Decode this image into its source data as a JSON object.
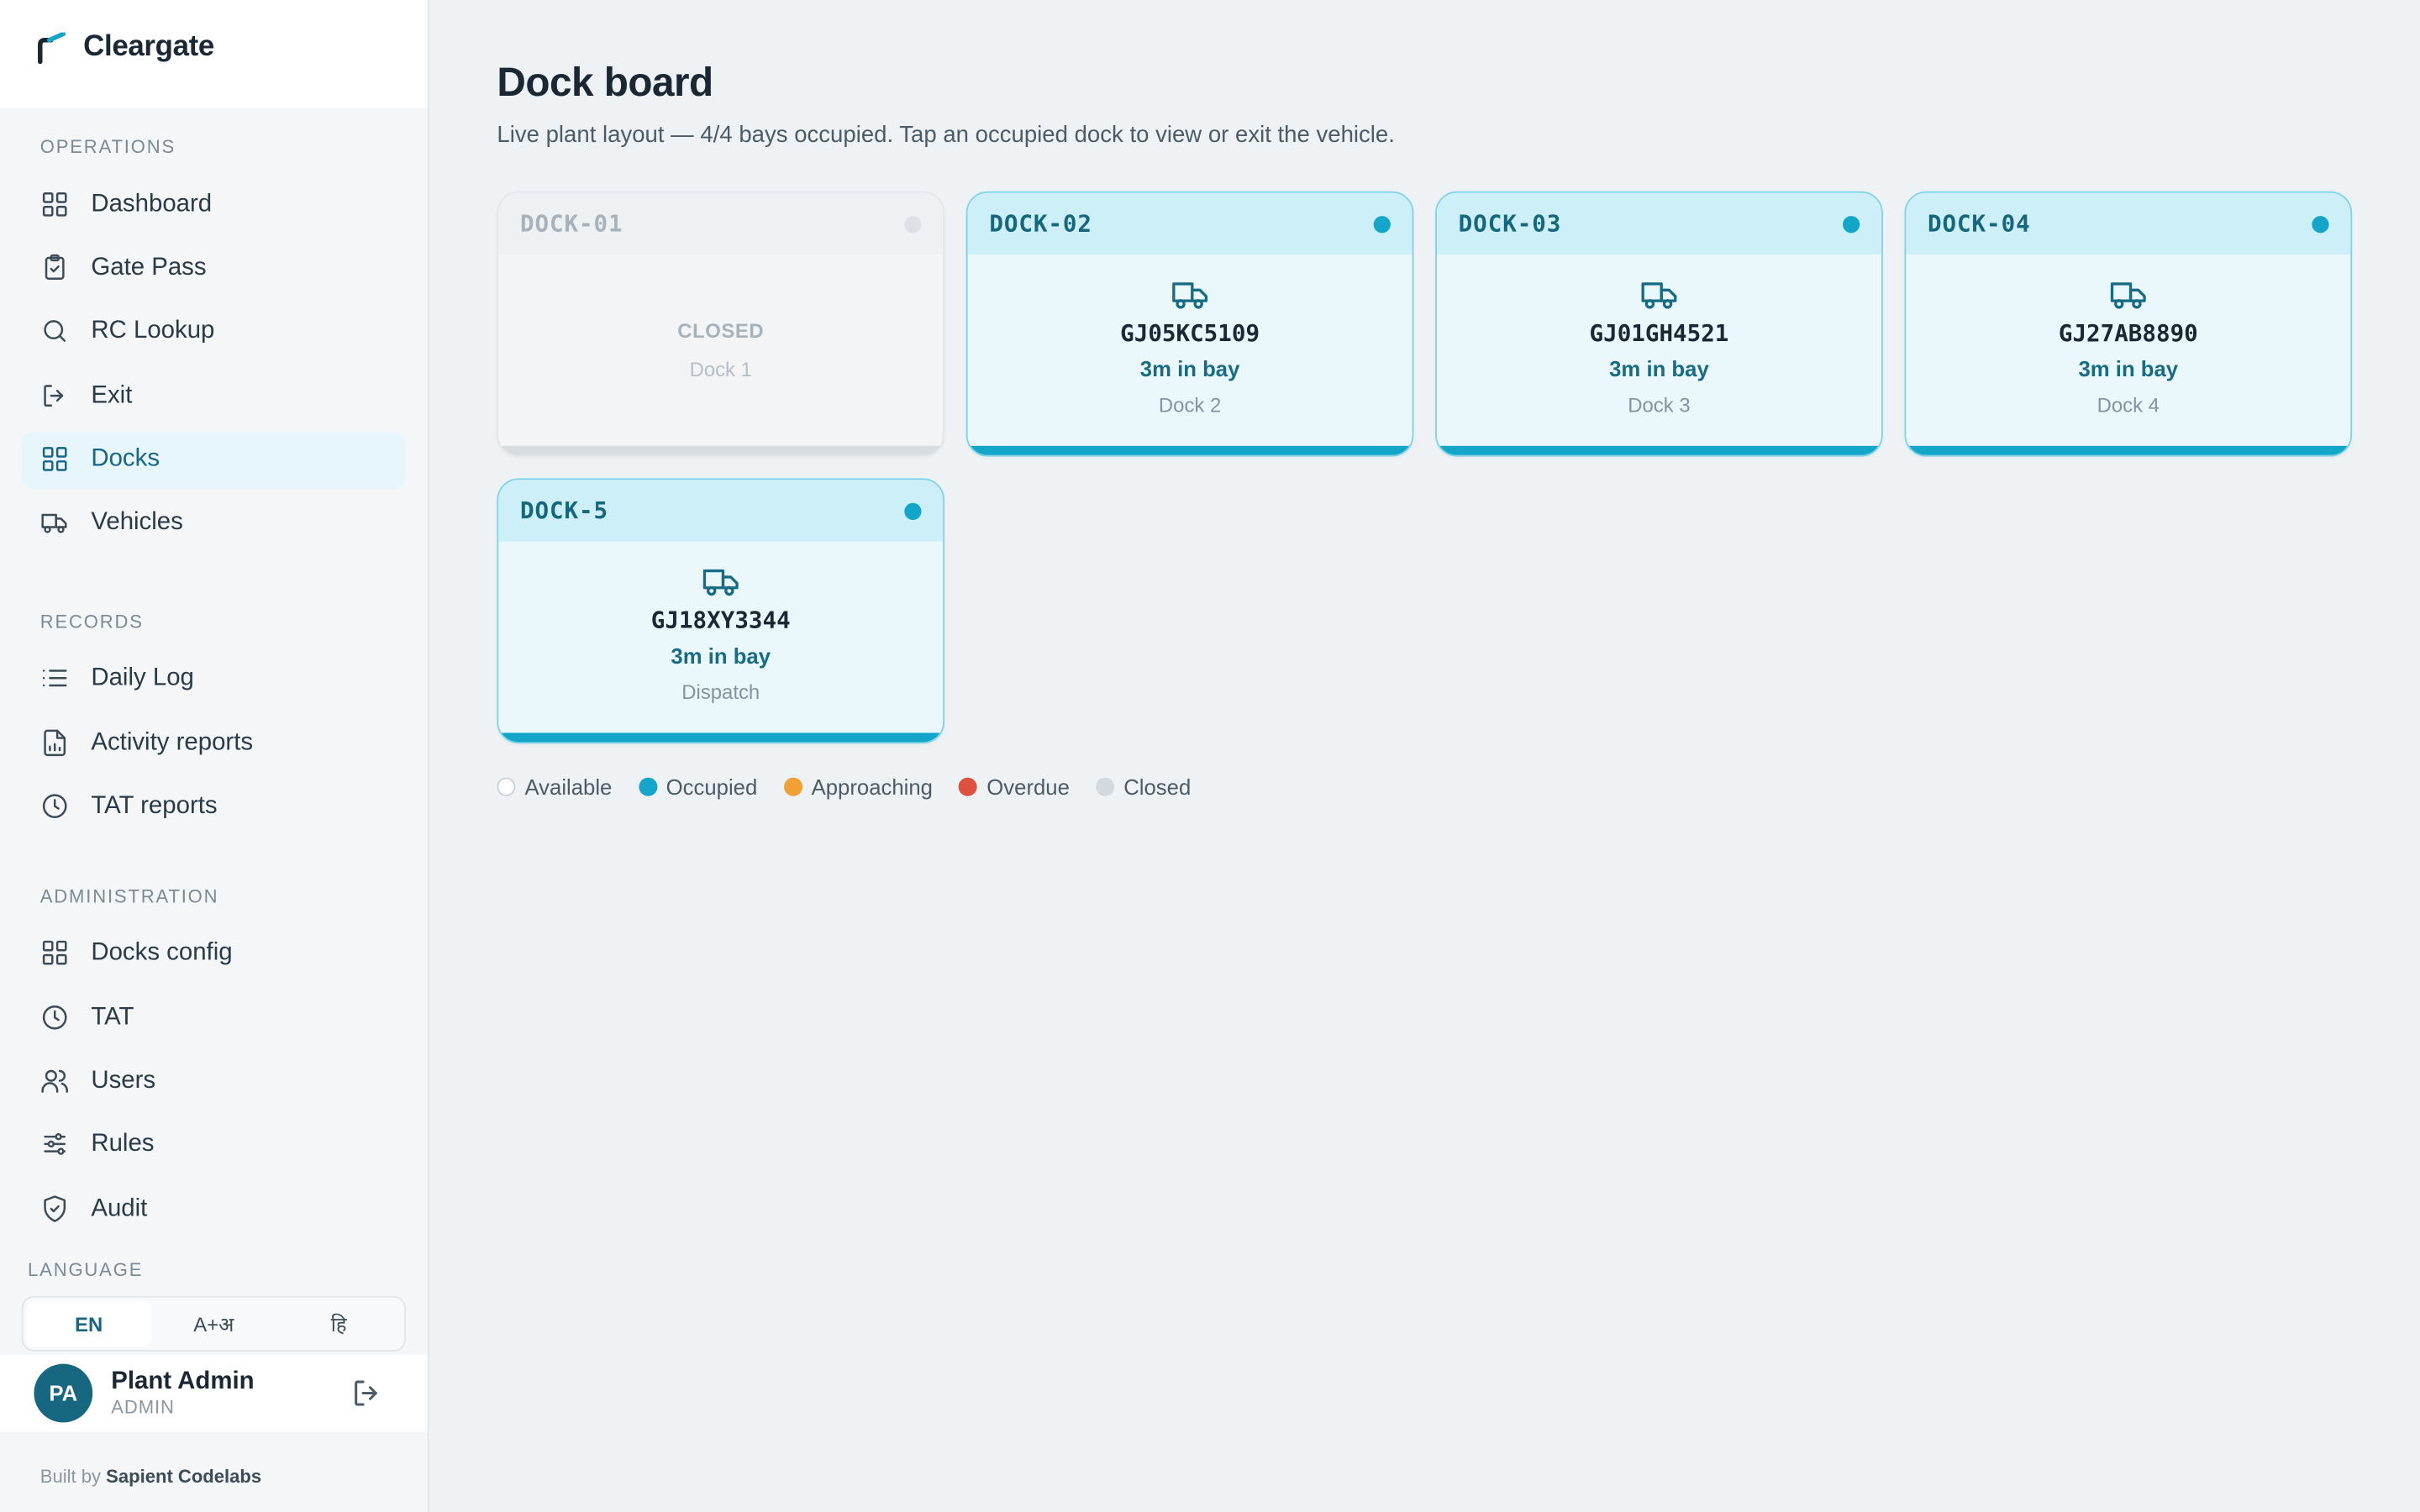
{
  "app": {
    "name": "Cleargate"
  },
  "sidebar": {
    "sections": [
      {
        "label": "OPERATIONS",
        "items": [
          {
            "label": "Dashboard",
            "icon": "grid-icon"
          },
          {
            "label": "Gate Pass",
            "icon": "clipboard-icon"
          },
          {
            "label": "RC Lookup",
            "icon": "search-icon"
          },
          {
            "label": "Exit",
            "icon": "log-out-icon"
          },
          {
            "label": "Docks",
            "icon": "grid-icon",
            "active": true
          },
          {
            "label": "Vehicles",
            "icon": "truck-icon"
          }
        ]
      },
      {
        "label": "RECORDS",
        "items": [
          {
            "label": "Daily Log",
            "icon": "list-icon"
          },
          {
            "label": "Activity reports",
            "icon": "file-chart-icon"
          },
          {
            "label": "TAT reports",
            "icon": "clock-icon"
          }
        ]
      },
      {
        "label": "ADMINISTRATION",
        "items": [
          {
            "label": "Docks config",
            "icon": "grid-icon"
          },
          {
            "label": "TAT",
            "icon": "clock-icon"
          },
          {
            "label": "Users",
            "icon": "users-icon"
          },
          {
            "label": "Rules",
            "icon": "sliders-icon"
          },
          {
            "label": "Audit",
            "icon": "shield-check-icon"
          }
        ]
      }
    ],
    "language": {
      "label": "LANGUAGE",
      "options": [
        "EN",
        "A+अ",
        "हि"
      ],
      "selected": "EN"
    },
    "user": {
      "initials": "PA",
      "name": "Plant Admin",
      "role": "ADMIN"
    },
    "footer": {
      "prefix": "Built by",
      "company": "Sapient Codelabs"
    }
  },
  "main": {
    "title": "Dock board",
    "subtitle": "Live plant layout — 4/4 bays occupied. Tap an occupied dock to view or exit the vehicle.",
    "docks": [
      {
        "code": "DOCK-01",
        "state": "closed",
        "status": "CLOSED",
        "name": "Dock 1"
      },
      {
        "code": "DOCK-02",
        "state": "occupied",
        "plate": "GJ05KC5109",
        "time": "3m in bay",
        "name": "Dock 2"
      },
      {
        "code": "DOCK-03",
        "state": "occupied",
        "plate": "GJ01GH4521",
        "time": "3m in bay",
        "name": "Dock 3"
      },
      {
        "code": "DOCK-04",
        "state": "occupied",
        "plate": "GJ27AB8890",
        "time": "3m in bay",
        "name": "Dock 4"
      },
      {
        "code": "DOCK-5",
        "state": "occupied",
        "plate": "GJ18XY3344",
        "time": "3m in bay",
        "name": "Dispatch"
      }
    ],
    "legend": [
      {
        "label": "Available",
        "color": "#ffffff"
      },
      {
        "label": "Occupied",
        "color": "#13a6c9"
      },
      {
        "label": "Approaching",
        "color": "#f0a035"
      },
      {
        "label": "Overdue",
        "color": "#e0503f"
      },
      {
        "label": "Closed",
        "color": "#d3d9de"
      }
    ]
  }
}
